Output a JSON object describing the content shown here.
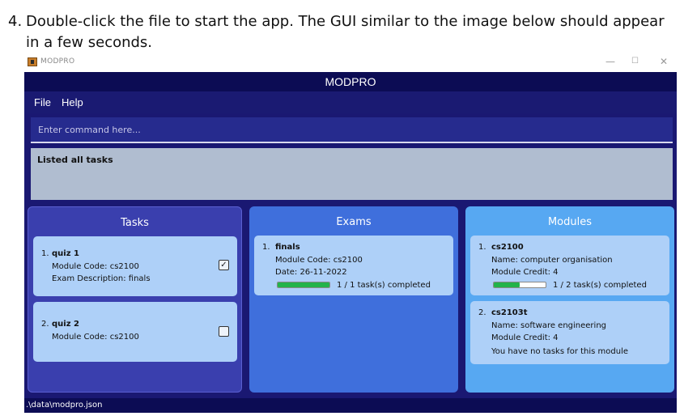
{
  "instruction": {
    "number": "4.",
    "text": "Double-click the file to start the app. The GUI similar to the image below should appear in a few seconds."
  },
  "window": {
    "titlebar_title": "MODPRO",
    "min_glyph": "—",
    "max_glyph": "☐",
    "close_glyph": "✕"
  },
  "app": {
    "title": "MODPRO",
    "menu": [
      "File",
      "Help"
    ],
    "command_placeholder": "Enter command here...",
    "result": "Listed all tasks",
    "status_path": ".\\data\\modpro.json",
    "colors": {
      "title_bar": "#0c0c54",
      "background": "#1a1872",
      "tasks_panel": "#3a3fae",
      "exams_panel": "#3f6fdc",
      "modules_panel": "#57a8f2",
      "card": "#aed0f8",
      "progress": "#22b34a"
    }
  },
  "tasks": {
    "header": "Tasks",
    "items": [
      {
        "index": "1.",
        "name": "quiz 1",
        "module": "Module Code: cs2100",
        "desc": "Exam Description: finals",
        "check_glyph": "✓",
        "done": true
      },
      {
        "index": "2.",
        "name": "quiz 2",
        "module": "Module Code: cs2100",
        "check_glyph": "",
        "done": false
      }
    ]
  },
  "exams": {
    "header": "Exams",
    "items": [
      {
        "index": "1.",
        "name": "finals",
        "module": "Module Code: cs2100",
        "date": "Date: 26-11-2022",
        "progress_text": "1 / 1 task(s) completed",
        "progress": 1.0
      }
    ]
  },
  "modules": {
    "header": "Modules",
    "items": [
      {
        "index": "1.",
        "code": "cs2100",
        "name": "Name: computer organisation",
        "credit": "Module Credit: 4",
        "progress_text": "1 / 2 task(s) completed",
        "progress": 0.5
      },
      {
        "index": "2.",
        "code": "cs2103t",
        "name": "Name: software engineering",
        "credit": "Module Credit: 4",
        "note": "You have no tasks for this module"
      }
    ]
  }
}
